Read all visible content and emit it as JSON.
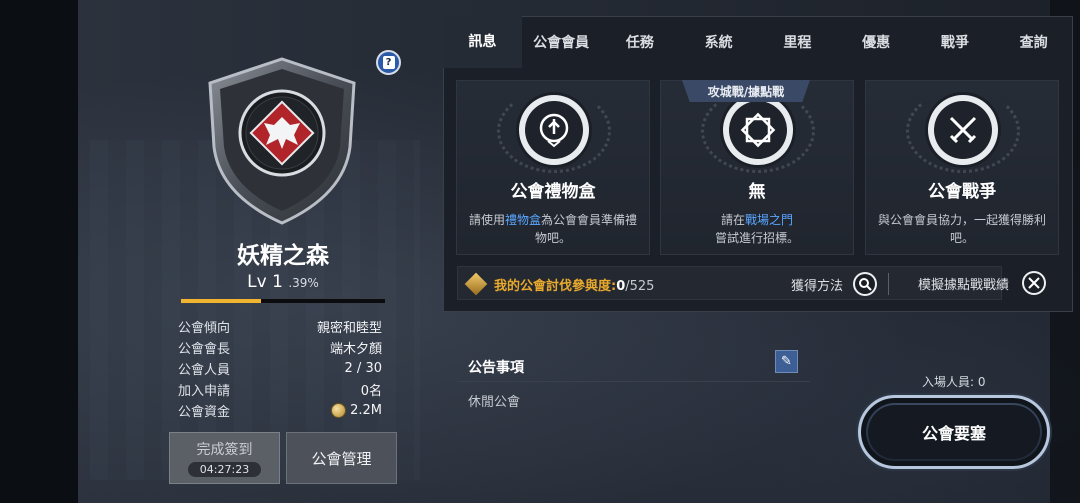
{
  "guild": {
    "name": "妖精之森",
    "level_label": "Lv 1",
    "level_percent": ".39%",
    "progress": 0.39,
    "info": [
      {
        "key": "公會傾向",
        "value": "親密和睦型"
      },
      {
        "key": "公會會長",
        "value": "端木夕顏"
      },
      {
        "key": "公會人員",
        "value": "2 / 30"
      },
      {
        "key": "加入申請",
        "value": "0名"
      },
      {
        "key": "公會資金",
        "value": "2.2M"
      }
    ],
    "checkin_label": "完成簽到",
    "checkin_timer": "04:27:23",
    "manage_label": "公會管理"
  },
  "tabs": [
    "訊息",
    "公會會員",
    "任務",
    "系統",
    "里程",
    "優惠",
    "戰爭",
    "查詢"
  ],
  "cards": {
    "gift": {
      "title": "公會禮物盒",
      "desc_pre": "請使用",
      "desc_hl": "禮物盒",
      "desc_post": "為公會會員準備禮物吧。"
    },
    "siege": {
      "ribbon": "攻城戰/據點戰",
      "title": "無",
      "desc_pre": "請在",
      "desc_hl": "戰場之門",
      "desc_post": "嘗試進行招標。"
    },
    "war": {
      "title": "公會戰爭",
      "desc": "與公會會員協力，一起獲得勝利吧。"
    }
  },
  "footer": {
    "label": "我的公會討伐參與度:",
    "current": "0",
    "max": "/525",
    "how_label": "獲得方法",
    "sim_label": "模擬據點戰戰績"
  },
  "notice": {
    "title": "公告事項",
    "body": "休閒公會"
  },
  "entry_label": "入場人員: 0",
  "fortress_label": "公會要塞",
  "colors": {
    "accent_gold": "#f1b430",
    "link_blue": "#5aa7ff"
  }
}
